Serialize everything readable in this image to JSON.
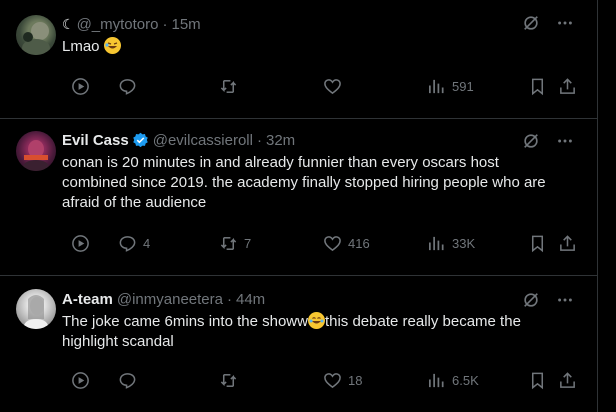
{
  "posts": [
    {
      "prefix_icon": "crescent-moon",
      "name": "",
      "handle": "@_mytotoro",
      "time": "15m",
      "verified": false,
      "text": "Lmao ",
      "emoji": "rolling-on-floor-laughing",
      "replies": "",
      "reposts": "",
      "likes": "",
      "views": "591"
    },
    {
      "name": "Evil Cass",
      "handle": "@evilcassieroll",
      "time": "32m",
      "verified": true,
      "text": "conan is 20 minutes in and already funnier than every oscars host combined since 2019. the academy finally stopped hiring people who are afraid of the audience",
      "replies": "4",
      "reposts": "7",
      "likes": "416",
      "views": "33K"
    },
    {
      "name": "A-team",
      "handle": "@inmyaneetera",
      "time": "44m",
      "verified": false,
      "text_before": "The joke came 6mins into the showw",
      "emoji": "face-with-tears-of-joy",
      "text_after": "this debate really became the highlight scandal",
      "replies": "",
      "reposts": "",
      "likes": "18",
      "views": "6.5K"
    }
  ],
  "colors": {
    "background": "#000000",
    "text": "#e7e9ea",
    "muted": "#71767b",
    "border": "#2f3336",
    "verified": "#1d9bf0"
  },
  "sep": "·"
}
